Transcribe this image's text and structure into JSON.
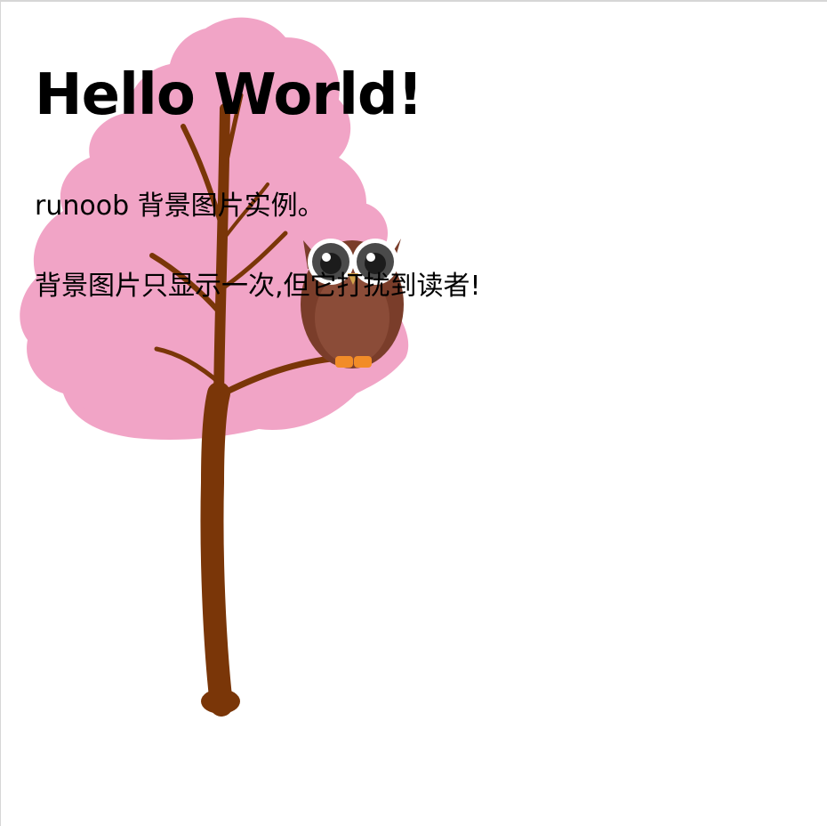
{
  "page": {
    "heading": "Hello World!",
    "paragraphs": [
      "runoob 背景图片实例。",
      "背景图片只显示一次,但它打扰到读者!"
    ]
  },
  "background_image": {
    "subject": "pink tree with an owl on a branch",
    "colors": {
      "foliage": "#f1a4c6",
      "trunk": "#7a3608",
      "owl_body": "#7a3d2a",
      "owl_belly": "#8b4c38",
      "owl_feet": "#f28c28"
    }
  }
}
